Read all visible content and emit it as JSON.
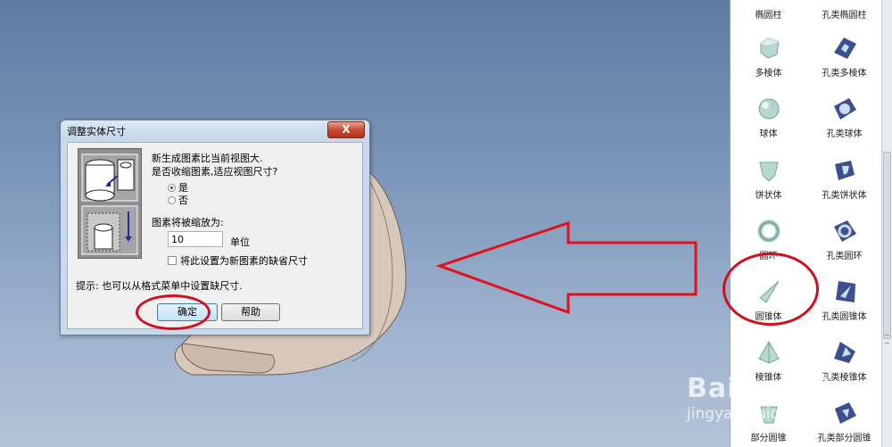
{
  "dialog": {
    "title": "调整实体尺寸",
    "close_label": "X",
    "message_line1": "新生成图素比当前视图大.",
    "message_line2": "是否收缩图素,适应视图尺寸?",
    "radio_yes": "是",
    "radio_no": "否",
    "scale_label": "图素将被缩放为:",
    "scale_value": "10",
    "unit_label": "单位",
    "checkbox_label": "将此设置为新图素的缺省尺寸",
    "hint": "提示: 也可以从格式菜单中设置缺尺寸.",
    "ok_label": "确定",
    "help_label": "帮助"
  },
  "panel": {
    "items": [
      {
        "left": "椭圆柱",
        "right": "孔类椭圆柱"
      },
      {
        "left": "多棱体",
        "right": "孔类多棱体"
      },
      {
        "left": "球体",
        "right": "孔类球体"
      },
      {
        "left": "饼状体",
        "right": "孔类饼状体"
      },
      {
        "left": "圆环",
        "right": "孔类圆环"
      },
      {
        "left": "圆锥体",
        "right": "孔类圆锥体"
      },
      {
        "left": "棱锥体",
        "right": "孔类棱锥体"
      },
      {
        "left": "部分圆锥",
        "right": "孔类部分圆锥"
      }
    ]
  },
  "watermark": {
    "brand": "Baidu经验",
    "url": "jingyan.baidu.com"
  }
}
